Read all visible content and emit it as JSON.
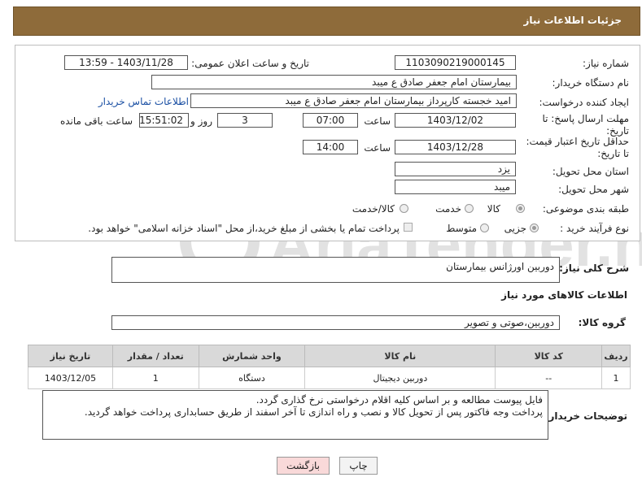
{
  "header": {
    "title": "جزئیات اطلاعات نیاز"
  },
  "form": {
    "need_number_label": "شماره نیاز:",
    "need_number": "1103090219000145",
    "announce_label": "تاریخ و ساعت اعلان عمومی:",
    "announce_value": "1403/11/28 - 13:59",
    "buyer_org_label": "نام دستگاه خریدار:",
    "buyer_org": "بیمارستان امام جعفر صادق  ع  میبد",
    "creator_label": "ایجاد کننده درخواست:",
    "creator": "امید خجسته کارپرداز بیمارستان امام جعفر صادق  ع  میبد",
    "contact_link": "اطلاعات تماس خریدار",
    "reply_deadline_label": "مهلت ارسال پاسخ: تا تاریخ:",
    "reply_date": "1403/12/02",
    "time_label": "ساعت",
    "reply_time": "07:00",
    "days_value": "3",
    "days_label": "روز و",
    "remaining_time": "15:51:02",
    "remaining_label": "ساعت باقی مانده",
    "validity_label": "حداقل تاریخ اعتبار قیمت: تا تاریخ:",
    "validity_date": "1403/12/28",
    "validity_time": "14:00",
    "province_label": "استان محل تحویل:",
    "province": "یزد",
    "city_label": "شهر محل تحویل:",
    "city": "میبد",
    "category_label": "طبقه بندی موضوعی:",
    "category_options": [
      "کالا",
      "خدمت",
      "کالا/خدمت"
    ],
    "purchase_type_label": "نوع فرآیند خرید :",
    "purchase_options": [
      "جزیی",
      "متوسط"
    ],
    "payment_note": "پرداخت تمام یا بخشی از مبلغ خرید،از محل \"اسناد خزانه اسلامی\" خواهد بود."
  },
  "description": {
    "label": "شرح کلی نیاز:",
    "value": "دوربین اورژانس بیمارستان"
  },
  "goods_info_title": "اطلاعات کالاهای مورد نیاز",
  "goods_group": {
    "label": "گروه کالا:",
    "value": "دوربین،صوتی و تصویر"
  },
  "table": {
    "headers": [
      "ردیف",
      "کد کالا",
      "نام کالا",
      "واحد شمارش",
      "تعداد / مقدار",
      "تاریخ نیاز"
    ],
    "rows": [
      [
        "1",
        "--",
        "دوربین دیجیتال",
        "دستگاه",
        "1",
        "1403/12/05"
      ]
    ]
  },
  "buyer_notes": {
    "label": "توضیحات خریدار:",
    "line1": "فایل پیوست مطالعه و بر اساس کلیه اقلام درخواستی نرخ گذاری گردد.",
    "line2": "پرداخت وجه فاکتور پس از تحویل کالا و نصب و راه اندازی تا آخر اسفند از طریق حسابداری پرداخت خواهد گردید."
  },
  "buttons": {
    "print": "چاپ",
    "back": "بازگشت"
  },
  "watermark_text": "AriaTender.neT",
  "colors": {
    "header_bg": "#8e6b3a",
    "back_button_bg": "#f9d9d9",
    "watermark": "#dcdcdc"
  }
}
